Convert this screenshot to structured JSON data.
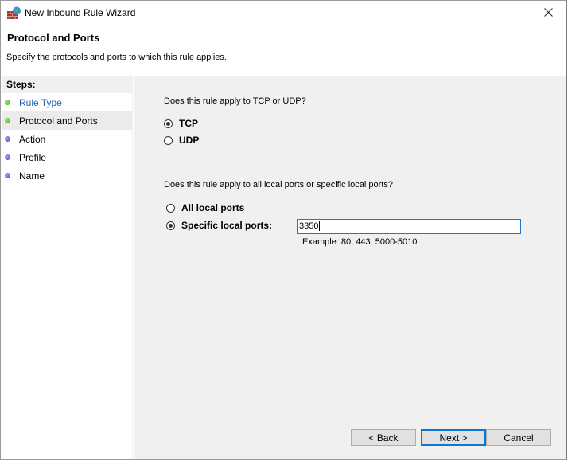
{
  "window": {
    "title": "New Inbound Rule Wizard",
    "icon": "firewall-icon",
    "close_icon": "close-icon"
  },
  "header": {
    "title": "Protocol and Ports",
    "subtitle": "Specify the protocols and ports to which this rule applies."
  },
  "sidebar": {
    "heading": "Steps:",
    "steps": [
      {
        "label": "Rule Type",
        "state": "completed-link"
      },
      {
        "label": "Protocol and Ports",
        "state": "current"
      },
      {
        "label": "Action",
        "state": "pending"
      },
      {
        "label": "Profile",
        "state": "pending"
      },
      {
        "label": "Name",
        "state": "pending"
      }
    ]
  },
  "protocol": {
    "question": "Does this rule apply to TCP or UDP?",
    "options": [
      {
        "label": "TCP",
        "selected": true
      },
      {
        "label": "UDP",
        "selected": false
      }
    ]
  },
  "ports": {
    "question": "Does this rule apply to all local ports or specific local ports?",
    "options": [
      {
        "label": "All local ports",
        "selected": false
      },
      {
        "label": "Specific local ports:",
        "selected": true
      }
    ],
    "value": "3350",
    "example": "Example: 80, 443, 5000-5010"
  },
  "buttons": {
    "back": "< Back",
    "next": "Next >",
    "cancel": "Cancel"
  },
  "colors": {
    "accent": "#0a78d7",
    "link": "#1d62b1",
    "completed_dot": "#3ea726",
    "pending_dot": "#5444b8"
  }
}
